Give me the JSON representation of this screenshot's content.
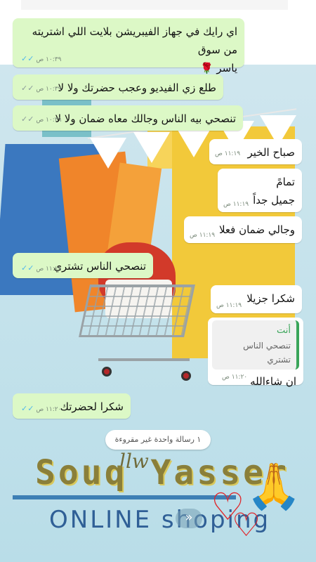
{
  "header_fragment": "",
  "messages": [
    {
      "id": 1,
      "dir": "out",
      "text_line1": "اي رايك في جهاز الفيبريشن بلايت اللي اشتريته من سوق",
      "text_line2": "ياسر 🌹",
      "time": "١٠:٣٩ ص",
      "ticks": "✓✓"
    },
    {
      "id": 2,
      "dir": "out",
      "text": "طلع زي الفيديو وعجب حضرتك ولا لا",
      "time": "١٠:٣٩ ص",
      "ticks": "✓✓"
    },
    {
      "id": 3,
      "dir": "out",
      "text": "تنصحي بيه الناس وجالك معاه ضمان ولا لا",
      "time": "١٠:٣٩ ص",
      "ticks": "✓✓"
    },
    {
      "id": 4,
      "dir": "in",
      "text": "صباح الخير",
      "time": "١١:١٩ ص"
    },
    {
      "id": 5,
      "dir": "in",
      "text_line1": "تمامً",
      "text_line2": "جميل جداً",
      "time": "١١:١٩ ص"
    },
    {
      "id": 6,
      "dir": "in",
      "text": "وجالي ضمان فعلا",
      "time": "١١:١٩ ص"
    },
    {
      "id": 7,
      "dir": "out",
      "text": "تنصحي الناس تشتري",
      "time": "١١:١٩ ص",
      "ticks": "✓✓"
    },
    {
      "id": 8,
      "dir": "in",
      "text": "شكرا جزيلا",
      "time": "١١:١٩ ص"
    },
    {
      "id": 9,
      "dir": "in",
      "quote_name": "أنت",
      "quote_text": "تنصحي الناس تشتري",
      "text": "ان شاءالله",
      "time": "١١:٢٠ ص"
    },
    {
      "id": 10,
      "dir": "out",
      "text": "شكرا لحضرتك",
      "time": "١١:٢٠ ص",
      "ticks": "✓✓"
    }
  ],
  "unread_banner": "١ رسالة واحدة غير مقروءة",
  "background": {
    "brand_title": "Souq Yasser",
    "brand_sub": "ONLINE shoping",
    "script_word": "llw"
  },
  "forward_icon": "forward-arrow-icon",
  "colors": {
    "outgoing_bubble": "#dcf8c6",
    "incoming_bubble": "#ffffff",
    "read_ticks": "#4fb6ec",
    "quote_accent": "#3aa55a"
  }
}
